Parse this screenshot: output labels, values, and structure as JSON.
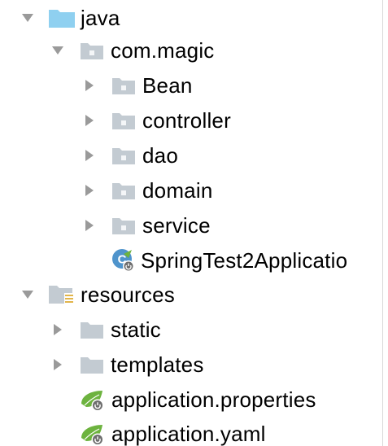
{
  "tree": {
    "items": [
      {
        "label": "java",
        "expanded": true,
        "type": "source-folder",
        "icon": "source-folder-icon"
      },
      {
        "label": "com.magic",
        "expanded": true,
        "type": "package",
        "icon": "package-folder-icon"
      },
      {
        "label": "Bean",
        "expanded": false,
        "type": "package",
        "icon": "package-folder-icon"
      },
      {
        "label": "controller",
        "expanded": false,
        "type": "package",
        "icon": "package-folder-icon"
      },
      {
        "label": "dao",
        "expanded": false,
        "type": "package",
        "icon": "package-folder-icon"
      },
      {
        "label": "domain",
        "expanded": false,
        "type": "package",
        "icon": "package-folder-icon"
      },
      {
        "label": "service",
        "expanded": false,
        "type": "package",
        "icon": "package-folder-icon"
      },
      {
        "label": "SpringTest2Applicatio",
        "type": "spring-boot-class",
        "icon": "spring-boot-app-icon"
      },
      {
        "label": "resources",
        "expanded": true,
        "type": "resources-folder",
        "icon": "resources-folder-icon"
      },
      {
        "label": "static",
        "expanded": false,
        "type": "folder",
        "icon": "folder-icon"
      },
      {
        "label": "templates",
        "expanded": false,
        "type": "folder",
        "icon": "folder-icon"
      },
      {
        "label": "application.properties",
        "type": "spring-config",
        "icon": "spring-config-icon"
      },
      {
        "label": "application.yaml",
        "type": "spring-config",
        "icon": "spring-config-icon"
      }
    ]
  },
  "colors": {
    "arrow": "#9a9a9a",
    "source_folder": "#8fd0f0",
    "folder": "#c3cbd2",
    "package_dot": "#f4f6f8",
    "resources_bars": "#e2b54a",
    "spring_leaf": "#6db33f",
    "spring_circle": "#4f94cc",
    "divider": "#d8d8d8"
  }
}
